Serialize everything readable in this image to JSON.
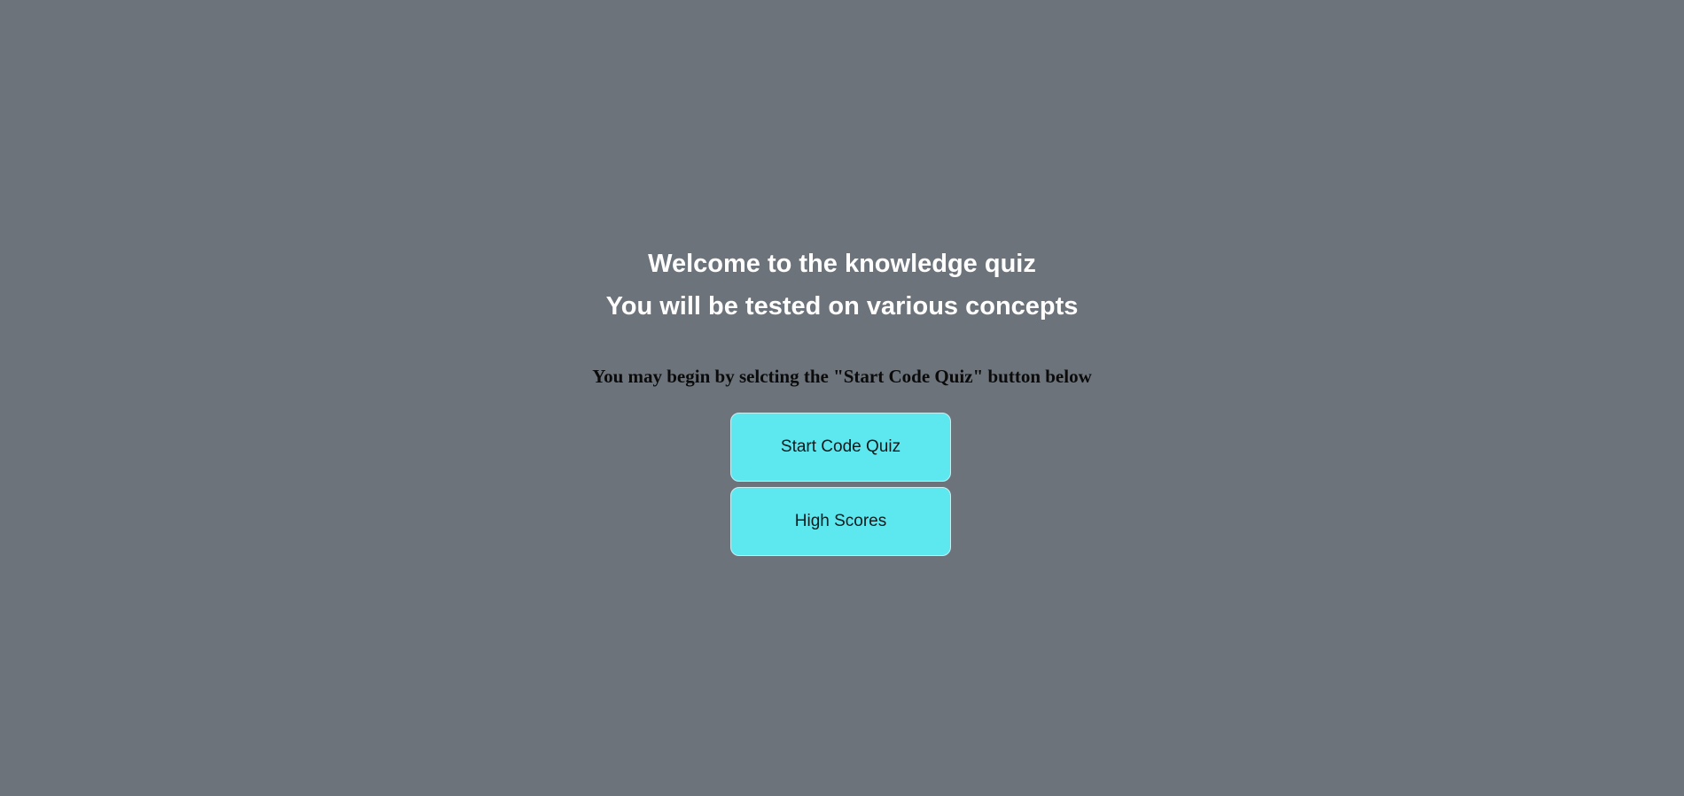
{
  "intro": {
    "title_line1": "Welcome to the knowledge quiz",
    "title_line2": "You will be tested on various concepts",
    "instruction": "You may begin by selcting the \"Start Code Quiz\" button below"
  },
  "buttons": {
    "start_label": "Start Code Quiz",
    "high_scores_label": "High Scores"
  },
  "colors": {
    "background": "#6c737b",
    "button": "#5de8f0",
    "heading_text": "#ffffff"
  }
}
